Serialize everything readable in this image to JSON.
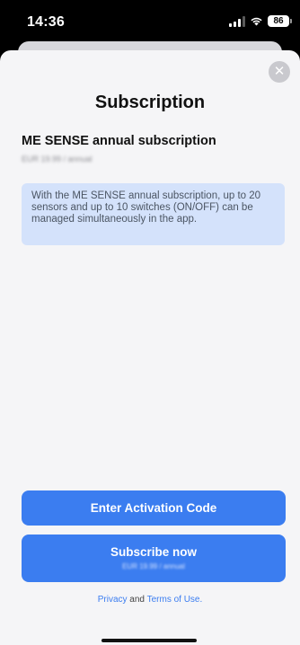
{
  "status_bar": {
    "time": "14:36",
    "battery": "86",
    "icons": [
      "signal-icon",
      "wifi-icon",
      "battery-icon"
    ]
  },
  "sheet": {
    "close_symbol": "✕",
    "title": "Subscription",
    "plan_name": "ME SENSE annual subscription",
    "plan_price": "EUR 19.99 / annual",
    "info_text": "With the ME SENSE annual subscription, up to 20 sensors and up to 10 switches (ON/OFF) can be managed simultaneously in the app."
  },
  "buttons": {
    "activation_label": "Enter Activation Code",
    "subscribe_label": "Subscribe now",
    "subscribe_price": "EUR 19.99 / annual"
  },
  "legal": {
    "privacy": "Privacy",
    "and": "and",
    "terms": "Terms of Use."
  },
  "colors": {
    "accent": "#3b7df0",
    "info_background": "#d4e2fb",
    "sheet_background": "#f5f5f7"
  }
}
